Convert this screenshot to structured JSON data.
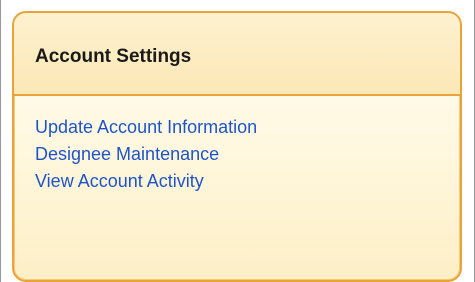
{
  "panel": {
    "title": "Account Settings",
    "links": [
      {
        "label": "Update Account Information"
      },
      {
        "label": "Designee Maintenance"
      },
      {
        "label": "View Account Activity"
      }
    ]
  },
  "colors": {
    "border": "#e8a33a",
    "link": "#1f54c8",
    "title": "#1a1a1a",
    "panel_bg": "#fff7dd"
  }
}
